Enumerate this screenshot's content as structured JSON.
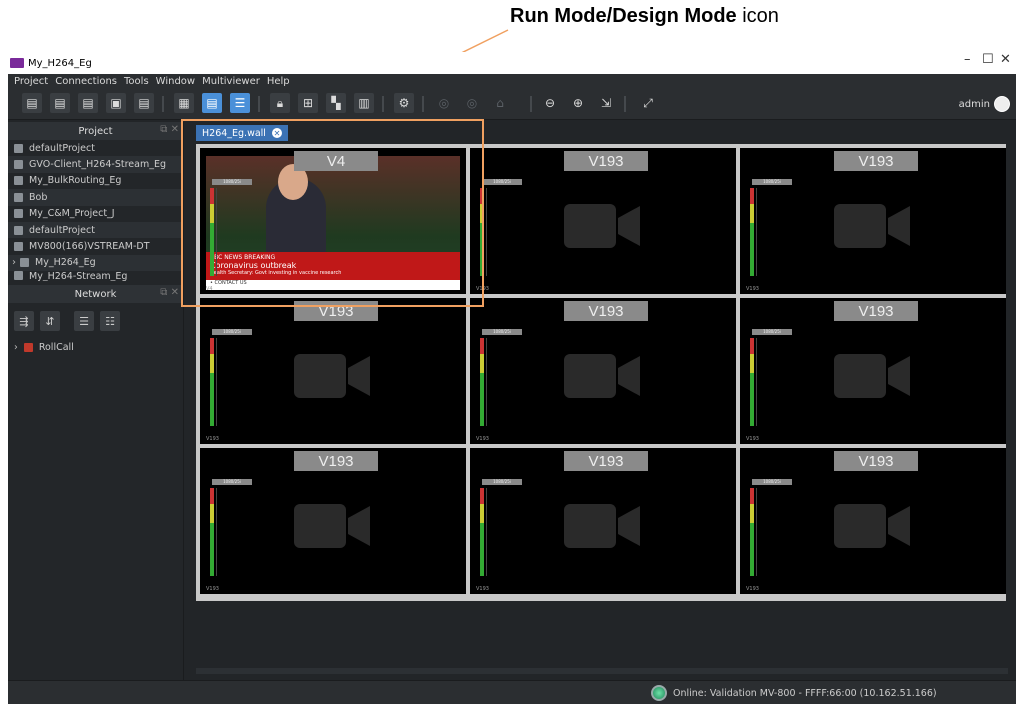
{
  "callout": {
    "bold": "Run Mode/Design Mode",
    "rest": " icon"
  },
  "window": {
    "title": "My_H264_Eg",
    "minimize": "–",
    "maximize": "☐",
    "close": "✕"
  },
  "menu": [
    "Project",
    "Connections",
    "Tools",
    "Window",
    "Multiviewer",
    "Help"
  ],
  "user": {
    "name": "admin"
  },
  "project_panel": {
    "title": "Project",
    "items": [
      {
        "label": "defaultProject"
      },
      {
        "label": "GVO-Client_H264-Stream_Eg"
      },
      {
        "label": "My_BulkRouting_Eg"
      },
      {
        "label": "Bob"
      },
      {
        "label": "My_C&M_Project_J"
      },
      {
        "label": "defaultProject"
      },
      {
        "label": "MV800(166)VSTREAM-DT"
      },
      {
        "label": "My_H264_Eg"
      },
      {
        "label": "My_H264-Stream_Eg"
      }
    ]
  },
  "network_panel": {
    "title": "Network",
    "tree": [
      {
        "label": "RollCall"
      }
    ]
  },
  "tab": {
    "label": "H264_Eg.wall"
  },
  "tiles": [
    {
      "label": "V4",
      "res": "1080/25i",
      "caption": "V4"
    },
    {
      "label": "V193",
      "res": "1080/25i",
      "caption": "V193"
    },
    {
      "label": "V193",
      "res": "1080/25i",
      "caption": "V193"
    },
    {
      "label": "V193",
      "res": "1080/25i",
      "caption": "V193"
    },
    {
      "label": "V193",
      "res": "1080/25i",
      "caption": "V193"
    },
    {
      "label": "V193",
      "res": "1080/25i",
      "caption": "V193"
    },
    {
      "label": "V193",
      "res": "1080/25i",
      "caption": "V193"
    },
    {
      "label": "V193",
      "res": "1080/25i",
      "caption": "V193"
    },
    {
      "label": "V193",
      "res": "1080/25i",
      "caption": "V193"
    }
  ],
  "broadcast": {
    "source": "HOUSE OF COMMONS",
    "brand": "BBC NEWS BREAKING",
    "headline": "Coronavirus outbreak",
    "sub": "Health Secretary: Govt investing in vaccine research",
    "contact": "• CONTACT US"
  },
  "status": {
    "text": "Online: Validation MV-800 - FFFF:66:00 (10.162.51.166)"
  },
  "colors": {
    "accent": "#4a90d9",
    "highlight": "#f0a060",
    "tab": "#3b72b4"
  }
}
